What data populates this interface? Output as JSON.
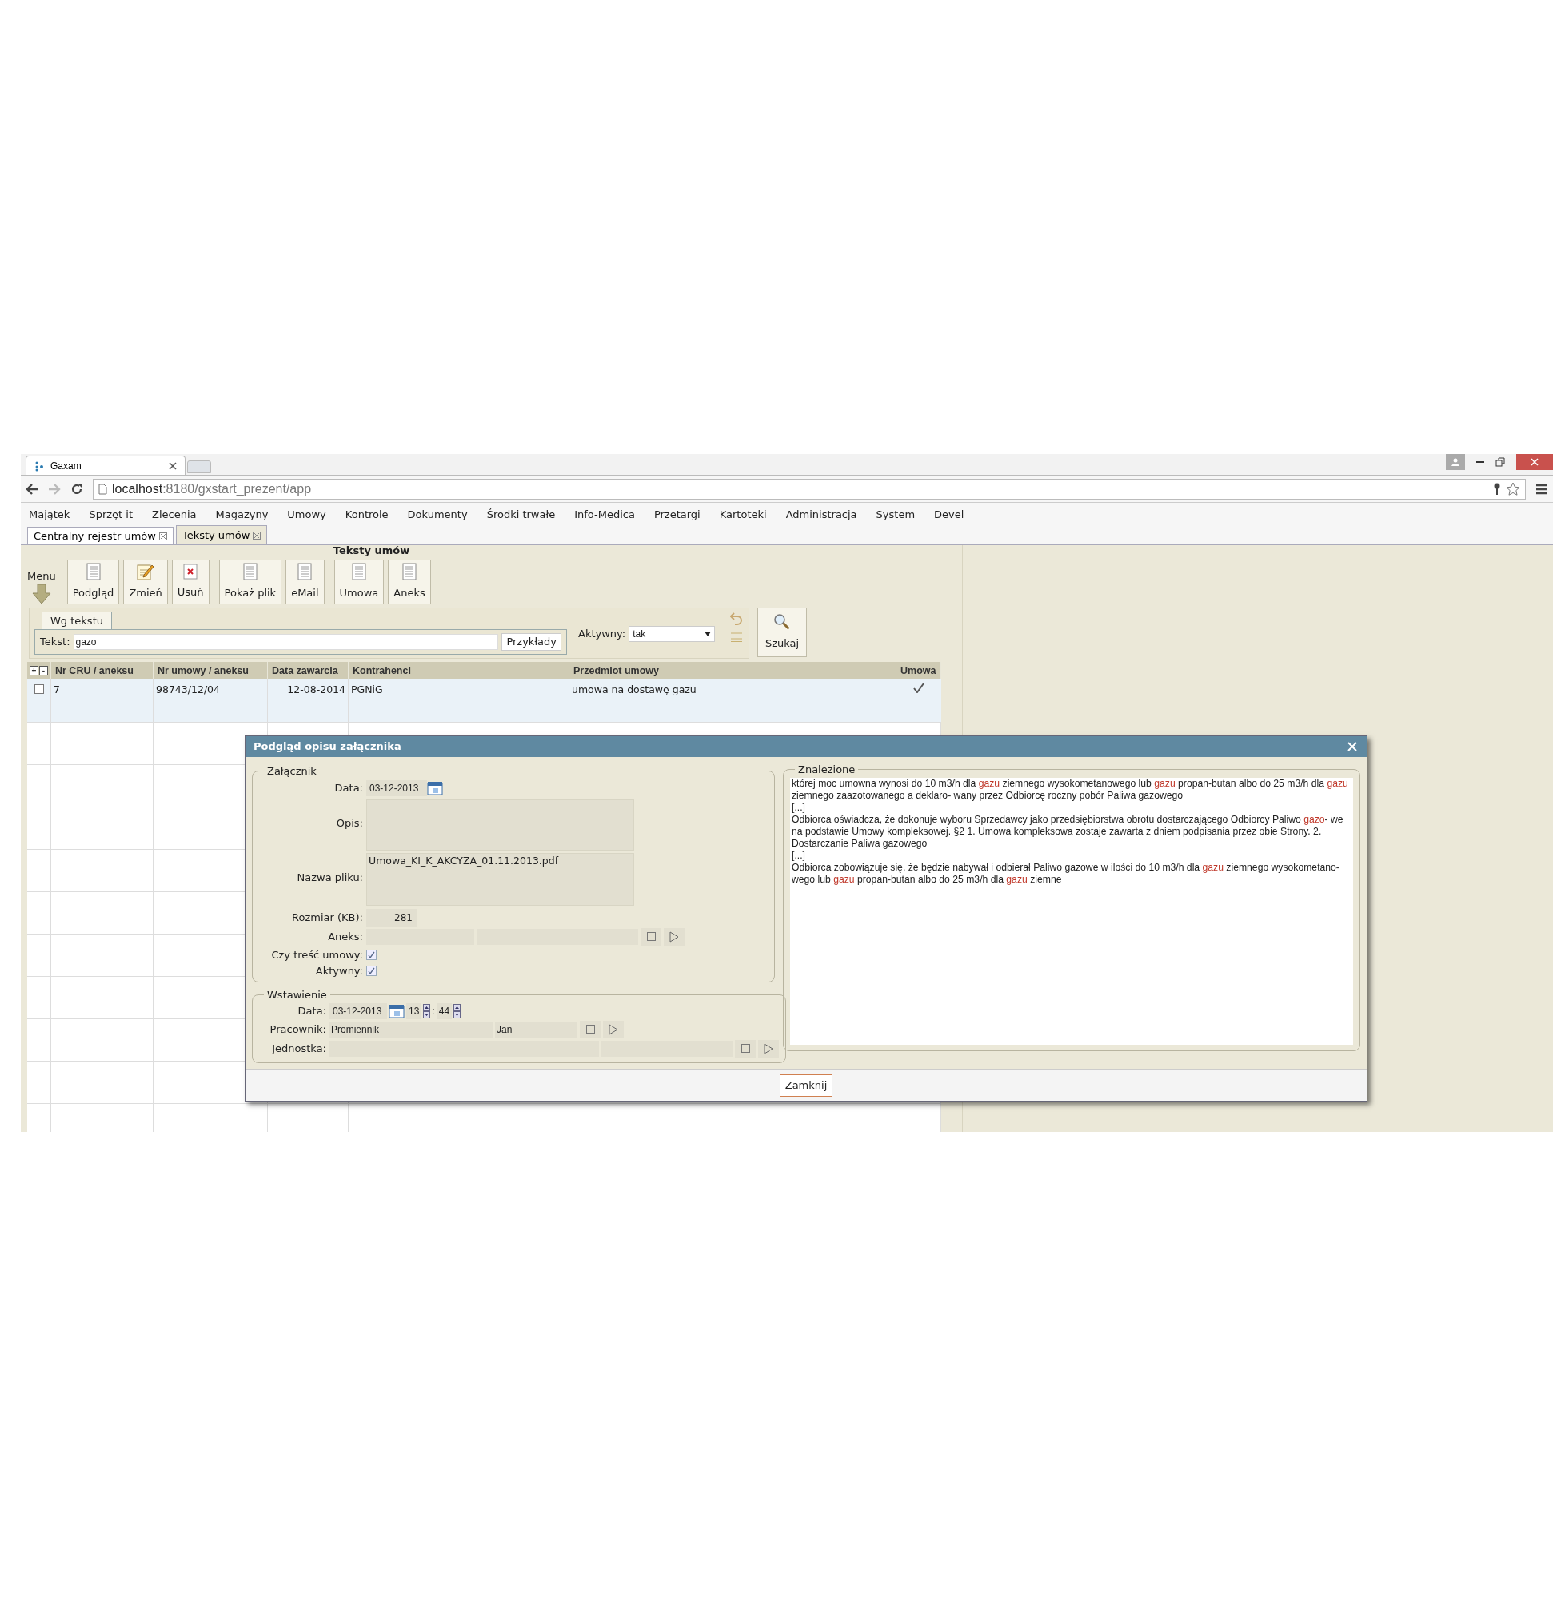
{
  "browser": {
    "tab_title": "Gaxam",
    "url_host": "localhost",
    "url_rest": ":8180/gxstart_prezent/app"
  },
  "menu": [
    "Majątek",
    "Sprzęt it",
    "Zlecenia",
    "Magazyny",
    "Umowy",
    "Kontrole",
    "Dokumenty",
    "Środki trwałe",
    "Info-Medica",
    "Przetargi",
    "Kartoteki",
    "Administracja",
    "System",
    "Devel"
  ],
  "tabs": [
    {
      "label": "Centralny rejestr umów",
      "selected": false
    },
    {
      "label": "Teksty umów",
      "selected": true
    }
  ],
  "page_title": "Teksty umów",
  "toolbar": {
    "menu_label": "Menu",
    "groups": [
      [
        {
          "label": "Podgląd",
          "kind": "document"
        },
        {
          "label": "Zmień",
          "kind": "edit"
        },
        {
          "label": "Usuń",
          "kind": "delete"
        }
      ],
      [
        {
          "label": "Pokaż plik",
          "kind": "document"
        },
        {
          "label": "eMail",
          "kind": "document"
        }
      ],
      [
        {
          "label": "Umowa",
          "kind": "document"
        },
        {
          "label": "Aneks",
          "kind": "document"
        }
      ]
    ]
  },
  "search": {
    "tab": "Wg tekstu",
    "text_label": "Tekst:",
    "text_value": "gazo",
    "examples_button": "Przykłady",
    "active_label": "Aktywny:",
    "active_value": "tak",
    "search_button": "Szukaj"
  },
  "table": {
    "expand": "+",
    "collapse": "-",
    "columns": [
      "Nr CRU / aneksu",
      "Nr umowy / aneksu",
      "Data zawarcia",
      "Kontrahenci",
      "Przedmiot umowy",
      "Umowa"
    ],
    "rows": [
      {
        "checked": false,
        "cells": [
          "7",
          "98743/12/04",
          "12-08-2014",
          "PGNiG",
          "umowa na dostawę gazu"
        ],
        "umowa": true
      }
    ]
  },
  "dialog": {
    "title": "Podgląd opisu załącznika",
    "attachment": {
      "legend": "Załącznik",
      "date_label": "Data:",
      "date": "03-12-2013",
      "description_label": "Opis:",
      "filename_label": "Nazwa pliku:",
      "filename": "Umowa_KI_K_AKCYZA_01.11.2013.pdf",
      "size_label": "Rozmiar (KB):",
      "size": "281",
      "annex_label": "Aneks:",
      "content_label": "Czy treść umowy:",
      "content_checked": true,
      "active_label": "Aktywny:",
      "active_checked": true
    },
    "insertion": {
      "legend": "Wstawienie",
      "date_label": "Data:",
      "date": "03-12-2013",
      "hour": "13",
      "separator": ":",
      "minute": "44",
      "employee_label": "Pracownik:",
      "employee_surname": "Promiennik",
      "employee_name": "Jan",
      "unit_label": "Jednostka:"
    },
    "found": {
      "legend": "Znalezione",
      "paragraphs": [
        [
          {
            "text": "której moc umowna wynosi do 10 m3/h dla ",
            "highlight": false
          },
          {
            "text": "gazu",
            "highlight": true
          },
          {
            "text": " ziemnego wysokometanowego lub ",
            "highlight": false
          },
          {
            "text": "gazu",
            "highlight": true
          },
          {
            "text": " propan-butan albo do 25 m3/h dla ",
            "highlight": false
          },
          {
            "text": "gazu",
            "highlight": true
          },
          {
            "text": " ziemnego zaazotowanego a deklaro- wany przez Odbiorcę roczny pobór Paliwa gazowego",
            "highlight": false
          }
        ],
        [
          {
            "text": "[...]",
            "highlight": false
          }
        ],
        [
          {
            "text": "Odbiorca oświadcza, że dokonuje wyboru Sprzedawcy jako przedsiębiorstwa obrotu dostarczającego Odbiorcy Paliwo ",
            "highlight": false
          },
          {
            "text": "gazo",
            "highlight": true
          },
          {
            "text": "- we na podstawie Umowy kompleksowej. §2 1. Umowa kompleksowa zostaje zawarta z dniem podpisania przez obie Strony. 2. Dostarczanie Paliwa gazowego",
            "highlight": false
          }
        ],
        [
          {
            "text": "[...]",
            "highlight": false
          }
        ],
        [
          {
            "text": "Odbiorca zobowiązuje się, że będzie nabywał i odbierał Paliwo gazowe w ilości do 10 m3/h dla ",
            "highlight": false
          },
          {
            "text": "gazu",
            "highlight": true
          },
          {
            "text": " ziemnego wysokometano- wego lub ",
            "highlight": false
          },
          {
            "text": "gazu",
            "highlight": true
          },
          {
            "text": " propan-butan albo do 25 m3/h dla ",
            "highlight": false
          },
          {
            "text": "gazu",
            "highlight": true
          },
          {
            "text": " ziemne",
            "highlight": false
          }
        ]
      ]
    },
    "close_button": "Zamknij"
  }
}
